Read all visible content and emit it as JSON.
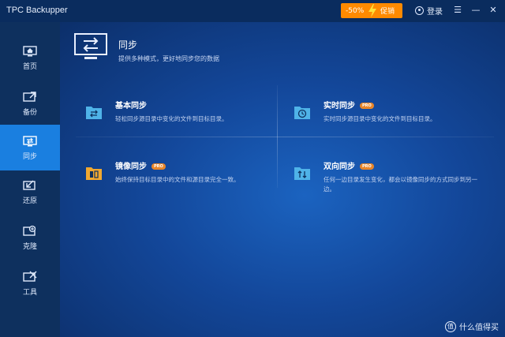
{
  "window": {
    "title": "TPC Backupper"
  },
  "promo": {
    "percent": "-50%",
    "button": "促销"
  },
  "login": {
    "label": "登录"
  },
  "window_controls": {
    "menu": "☰",
    "minimize": "—",
    "close": "✕"
  },
  "sidebar": {
    "items": [
      {
        "label": "首页",
        "icon": "home-monitor-icon",
        "active": false
      },
      {
        "label": "备份",
        "icon": "backup-icon",
        "active": false
      },
      {
        "label": "同步",
        "icon": "sync-icon",
        "active": true
      },
      {
        "label": "还原",
        "icon": "restore-icon",
        "active": false
      },
      {
        "label": "克隆",
        "icon": "clone-icon",
        "active": false
      },
      {
        "label": "工具",
        "icon": "tools-icon",
        "active": false
      }
    ]
  },
  "header": {
    "title": "同步",
    "subtitle": "提供多种模式，更好地同步您的数据"
  },
  "cards": [
    {
      "title": "基本同步",
      "pro": "",
      "desc": "轻松同步源目录中变化的文件到目标目录。",
      "icon": "basic-sync-folder-icon"
    },
    {
      "title": "实时同步",
      "pro": "PRO",
      "desc": "实时同步源目录中变化的文件到目标目录。",
      "icon": "realtime-sync-folder-icon"
    },
    {
      "title": "镜像同步",
      "pro": "PRO",
      "desc": "始终保持目标目录中的文件和源目录完全一致。",
      "icon": "mirror-sync-folder-icon"
    },
    {
      "title": "双向同步",
      "pro": "PRO",
      "desc": "任何一边目录发生变化，都会以镜像同步的方式同步到另一边。",
      "icon": "two-way-sync-folder-icon"
    }
  ],
  "watermark": {
    "logo": "值",
    "text": "什么值得买"
  },
  "colors": {
    "accent": "#1a7fe0",
    "promo": "#ff8a00",
    "folder": "#4fb3e8",
    "folder_orange": "#f0a830",
    "pro_badge": "#e8862a"
  }
}
